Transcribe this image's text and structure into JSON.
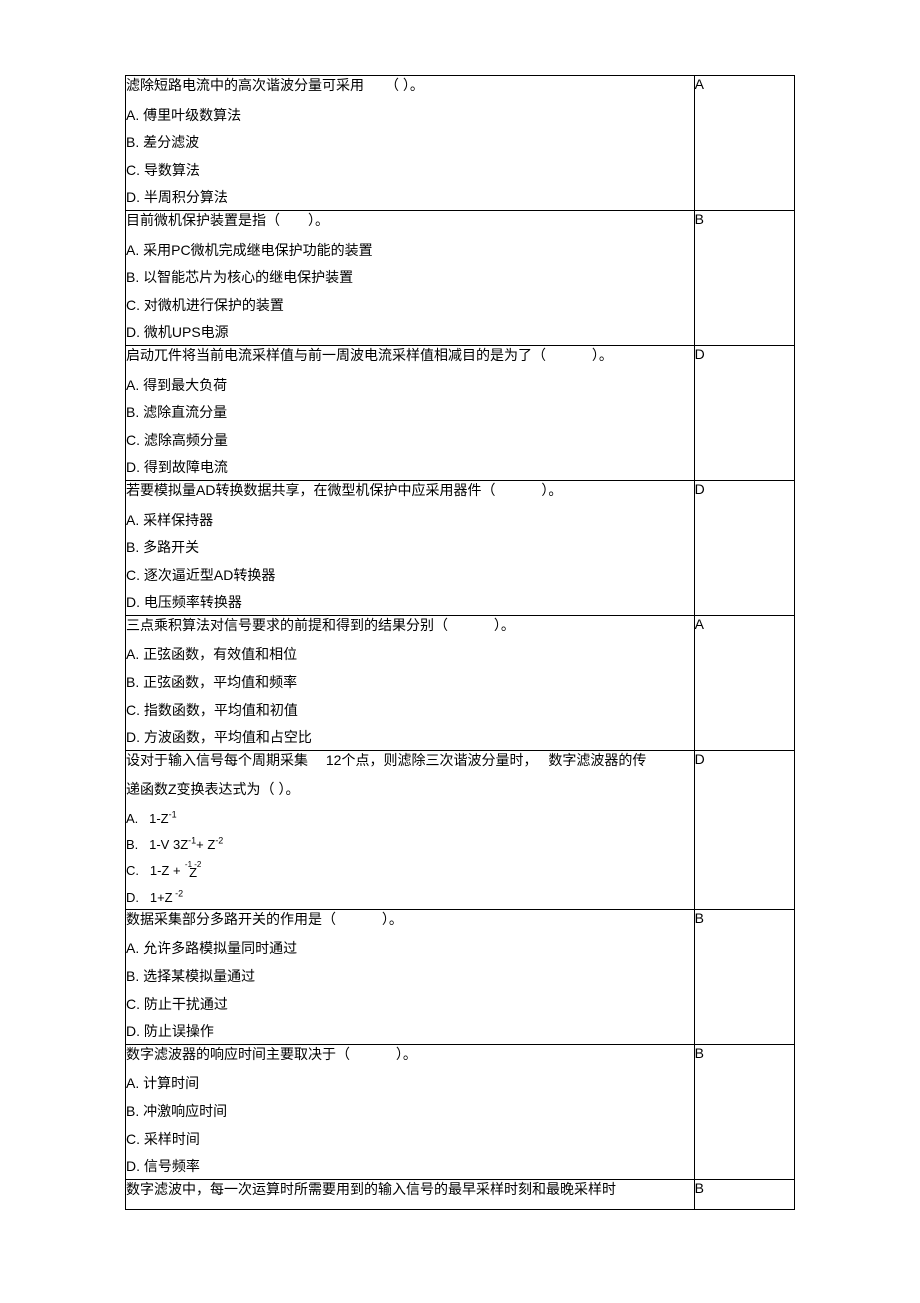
{
  "questions": [
    {
      "stem": "滤除短路电流中的高次谐波分量可采用　　（ ）。",
      "options": [
        "A.  傅里叶级数算法",
        "B.  差分滤波",
        "C.  导数算法",
        "  D.  半周积分算法"
      ],
      "answer": "A"
    },
    {
      "stem": "目前微机保护装置是指（　　）。",
      "options": [
        "A.  采用PC微机完成继电保护功能的装置",
        "B.  以智能芯片为核心的继电保护装置",
        "C.  对微机进行保护的装置",
        "D.  微机UPS电源"
      ],
      "answer": "B"
    },
    {
      "stem": "启动兀件将当前电流采样值与前一周波电流采样值相减目的是为了（　 　　）。",
      "options": [
        "A.  得到最大负荷",
        "B.  滤除直流分量",
        "C.  滤除高频分量",
        "D.  得到故障电流"
      ],
      "answer": "D"
    },
    {
      "stem": "若要模拟量AD转换数据共享，在微型机保护中应采用器件（　　　  ）。",
      "options": [
        "A.  采样保持器",
        "B.  多路开关",
        "C.  逐次逼近型AD转换器",
        "D.  电压频率转换器"
      ],
      "answer": "D"
    },
    {
      "stem": "三点乘积算法对信号要求的前提和得到的结果分别（　　　  ）。",
      "options": [
        "A.  正弦函数，有效值和相位",
        "B.  正弦函数，平均值和频率",
        "C.  指数函数，平均值和初值",
        "D.  方波函数，平均值和占空比"
      ],
      "answer": "A"
    },
    {
      "stem": "设对于输入信号每个周期采集　  12个点，则滤除三次谐波分量时，　  数字滤波器的传",
      "stem2": "递函数Z变换表达式为（ ）。",
      "formulas": [
        {
          "label": "A.",
          "expr": "1-Z",
          "sup": "-1"
        },
        {
          "label": "B.",
          "expr": "1-V 3Z",
          "sup": "-1",
          "extra": "+ Z",
          "sup2": "-2"
        },
        {
          "label": "C.",
          "stacked": true
        },
        {
          "label": "D.",
          "expr": "1+Z",
          "sup_offset": " -2",
          "sup_offset_only": true
        }
      ],
      "answer": "D"
    },
    {
      "stem": "数据采集部分多路开关的作用是（　 　　）。",
      "options": [
        "A.  允许多路模拟量同时通过",
        "B.  选择某模拟量通过",
        "C.  防止干扰通过",
        "D.  防止误操作"
      ],
      "answer": "B"
    },
    {
      "stem": "数字滤波器的响应时间主要取决于（　 　　）。",
      "options": [
        "A.  计算时间",
        "B.  冲激响应时间",
        "C.  采样时间",
        "D.  信号频率"
      ],
      "answer": "B"
    },
    {
      "stem": "数字滤波中，每一次运算时所需要用到的输入信号的最早采样时刻和最晚采样时",
      "options": [],
      "answer": "B"
    }
  ]
}
